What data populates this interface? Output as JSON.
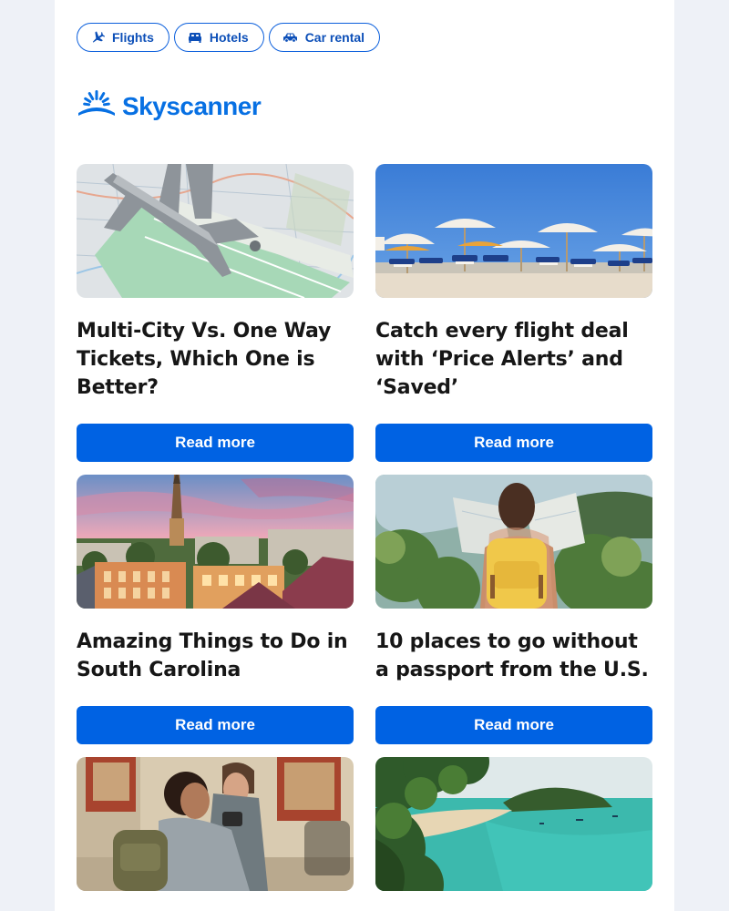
{
  "nav": {
    "flights": "Flights",
    "hotels": "Hotels",
    "car_rental": "Car rental"
  },
  "brand": {
    "name": "Skyscanner",
    "color": "#0770e3"
  },
  "accent": "#0062e3",
  "articles": [
    {
      "title": "Multi-City Vs. One Way Tickets, Which One is Better?",
      "button": "Read more",
      "image": "toy airplane on map with tickets"
    },
    {
      "title": "Catch every flight deal with ‘Price Alerts’ and ‘Saved’",
      "button": "Read more",
      "image": "beach umbrellas and sun loungers"
    },
    {
      "title": "Amazing Things to Do in South Carolina",
      "button": "Read more",
      "image": "Charleston skyline at sunset"
    },
    {
      "title": "10 places to go without a passport from the U.S.",
      "button": "Read more",
      "image": "traveler with yellow backpack reading map"
    },
    {
      "image": "travelers with backpacks taking photos"
    },
    {
      "image": "tropical bay with turquoise water"
    }
  ]
}
